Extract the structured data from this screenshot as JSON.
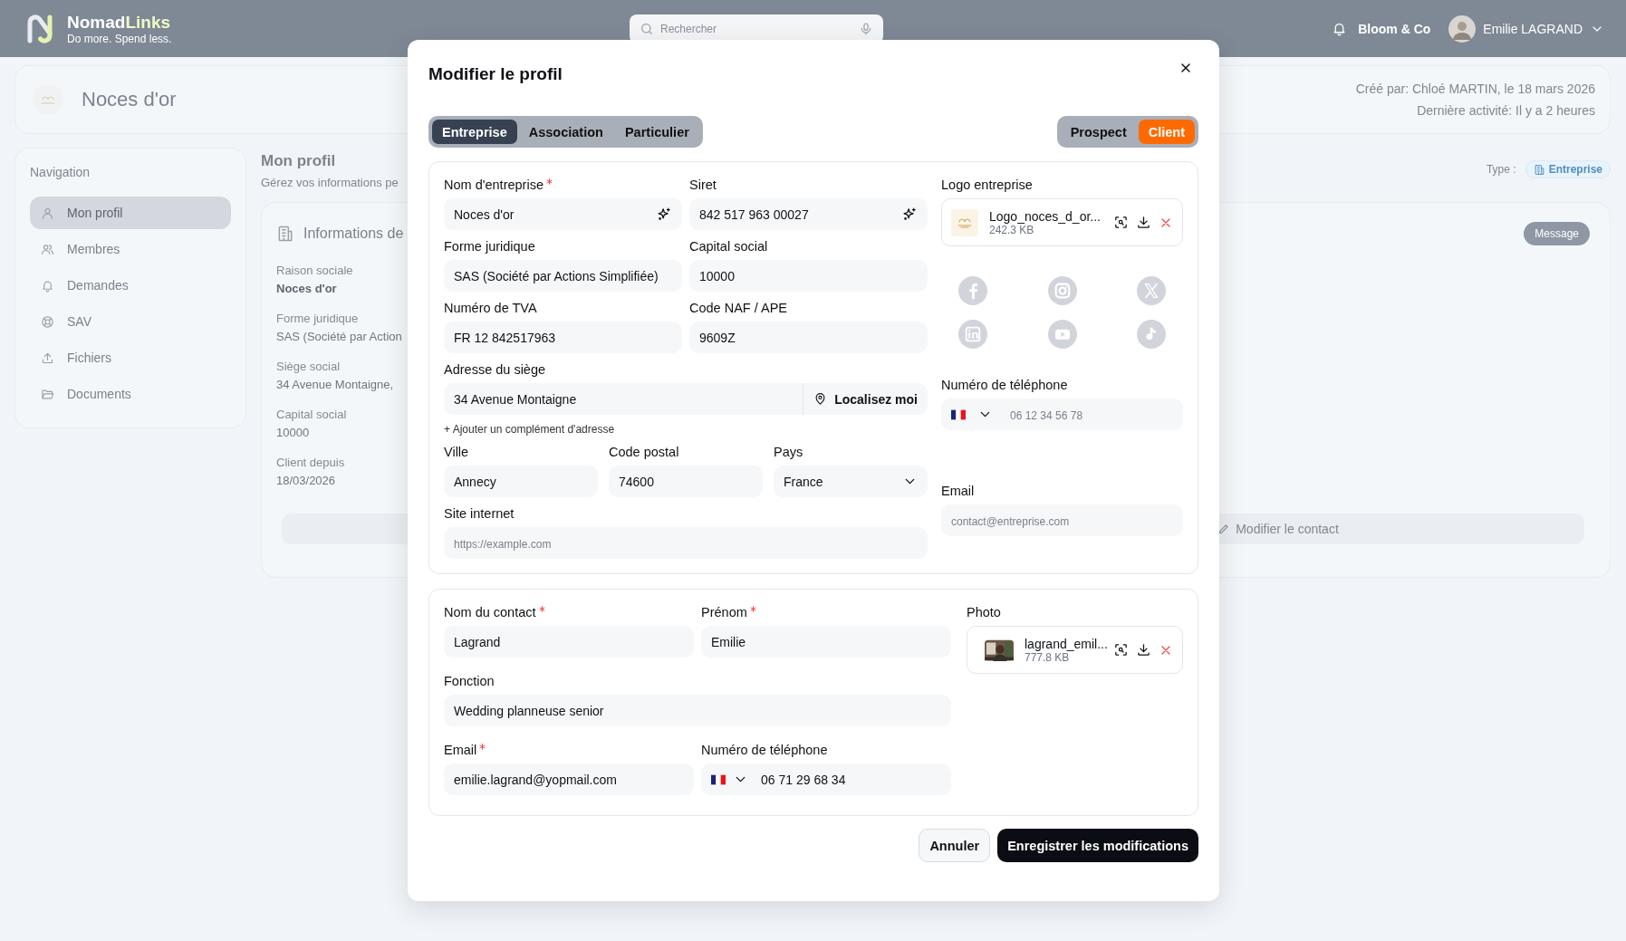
{
  "topbar": {
    "brand_name": "Nomad",
    "brand_accent": "Links",
    "tagline": "Do more. Spend less.",
    "search": {
      "placeholder": "Rechercher"
    },
    "company": "Bloom & Co",
    "user": "Emilie LAGRAND"
  },
  "header": {
    "title": "Noces d'or",
    "created": "Créé par: Chloé MARTIN, le 18 mars 2026",
    "activity": "Dernière activité: Il y a 2 heures"
  },
  "navigation": {
    "title": "Navigation",
    "items": [
      {
        "label": "Mon profil",
        "selected": true
      },
      {
        "label": "Membres",
        "selected": false
      },
      {
        "label": "Demandes",
        "selected": false
      },
      {
        "label": "SAV",
        "selected": false
      },
      {
        "label": "Fichiers",
        "selected": false
      },
      {
        "label": "Documents",
        "selected": false
      }
    ]
  },
  "profile": {
    "title": "Mon profil",
    "subtitle": "Gérez vos informations pe",
    "type_label": "Type :",
    "type_badge": "Entreprise",
    "card_title": "Informations de",
    "message_button": "Message",
    "edit_contact": "Modifier le contact",
    "fields": [
      {
        "label": "Raison sociale",
        "value": "Noces d'or",
        "bold": true
      },
      {
        "label": "Forme juridique",
        "value": "SAS (Société par Action",
        "bold": false
      },
      {
        "label": "Siège social",
        "value": "34 Avenue Montaigne,",
        "bold": false
      },
      {
        "label": "Capital social",
        "value": "10000",
        "bold": false
      },
      {
        "label": "Client depuis",
        "value": "18/03/2026",
        "bold": false
      }
    ]
  },
  "modal": {
    "title": "Modifier le profil",
    "types": [
      {
        "label": "Entreprise",
        "selected": true
      },
      {
        "label": "Association",
        "selected": false
      },
      {
        "label": "Particulier",
        "selected": false
      }
    ],
    "statuses": [
      {
        "label": "Prospect",
        "selected": false
      },
      {
        "label": "Client",
        "selected": true
      }
    ],
    "company": {
      "fields": [
        {
          "label": "Nom d'entreprise",
          "required": true,
          "value": "Noces d'or",
          "kind": "magic"
        },
        {
          "label": "Siret",
          "required": false,
          "value": "842 517 963 00027",
          "kind": "magic"
        },
        {
          "label": "Forme juridique",
          "required": false,
          "value": "SAS (Société par Actions Simplifiée)",
          "kind": "text"
        },
        {
          "label": "Capital social",
          "required": false,
          "value": "10000",
          "kind": "text"
        },
        {
          "label": "Numéro de TVA",
          "required": false,
          "value": "FR 12 842517963",
          "kind": "text"
        },
        {
          "label": "Code NAF / APE",
          "required": false,
          "value": "9609Z",
          "kind": "text"
        }
      ],
      "address": {
        "label": "Adresse du siège",
        "value": "34 Avenue Montaigne",
        "locate_button": "Localisez moi",
        "add_complement": "+ Ajouter un complément d'adresse"
      },
      "location": [
        {
          "label": "Ville",
          "value": "Annecy",
          "kind": "text"
        },
        {
          "label": "Code postal",
          "value": "74600",
          "kind": "text"
        },
        {
          "label": "Pays",
          "value": "France",
          "kind": "select"
        }
      ],
      "website": {
        "label": "Site internet",
        "placeholder": "https://example.com"
      },
      "logo": {
        "label": "Logo entreprise",
        "file_name": "Logo_noces_d_or...",
        "file_size": "242.3 KB"
      },
      "phone": {
        "label": "Numéro de téléphone",
        "placeholder": "06 12 34 56 78"
      },
      "email": {
        "label": "Email",
        "placeholder": "contact@entreprise.com"
      }
    },
    "contact": {
      "fields": [
        {
          "label": "Nom du contact",
          "required": true,
          "value": "Lagrand",
          "kind": "text"
        },
        {
          "label": "Prénom",
          "required": true,
          "value": "Emilie",
          "kind": "text"
        },
        {
          "label": "Fonction",
          "required": false,
          "value": "Wedding planneuse senior",
          "kind": "wide"
        },
        {
          "label": "Email",
          "required": true,
          "value": "emilie.lagrand@yopmail.com",
          "kind": "text"
        },
        {
          "label": "Numéro de téléphone",
          "required": false,
          "value": "06 71 29 68 34",
          "kind": "phone"
        }
      ],
      "photo": {
        "label": "Photo",
        "file_name": "lagrand_emil...",
        "file_size": "777.8 KB"
      }
    },
    "actions": [
      {
        "label": "Annuler",
        "kind": "secondary"
      },
      {
        "label": "Enregistrer les modifications",
        "kind": "primary"
      }
    ]
  }
}
